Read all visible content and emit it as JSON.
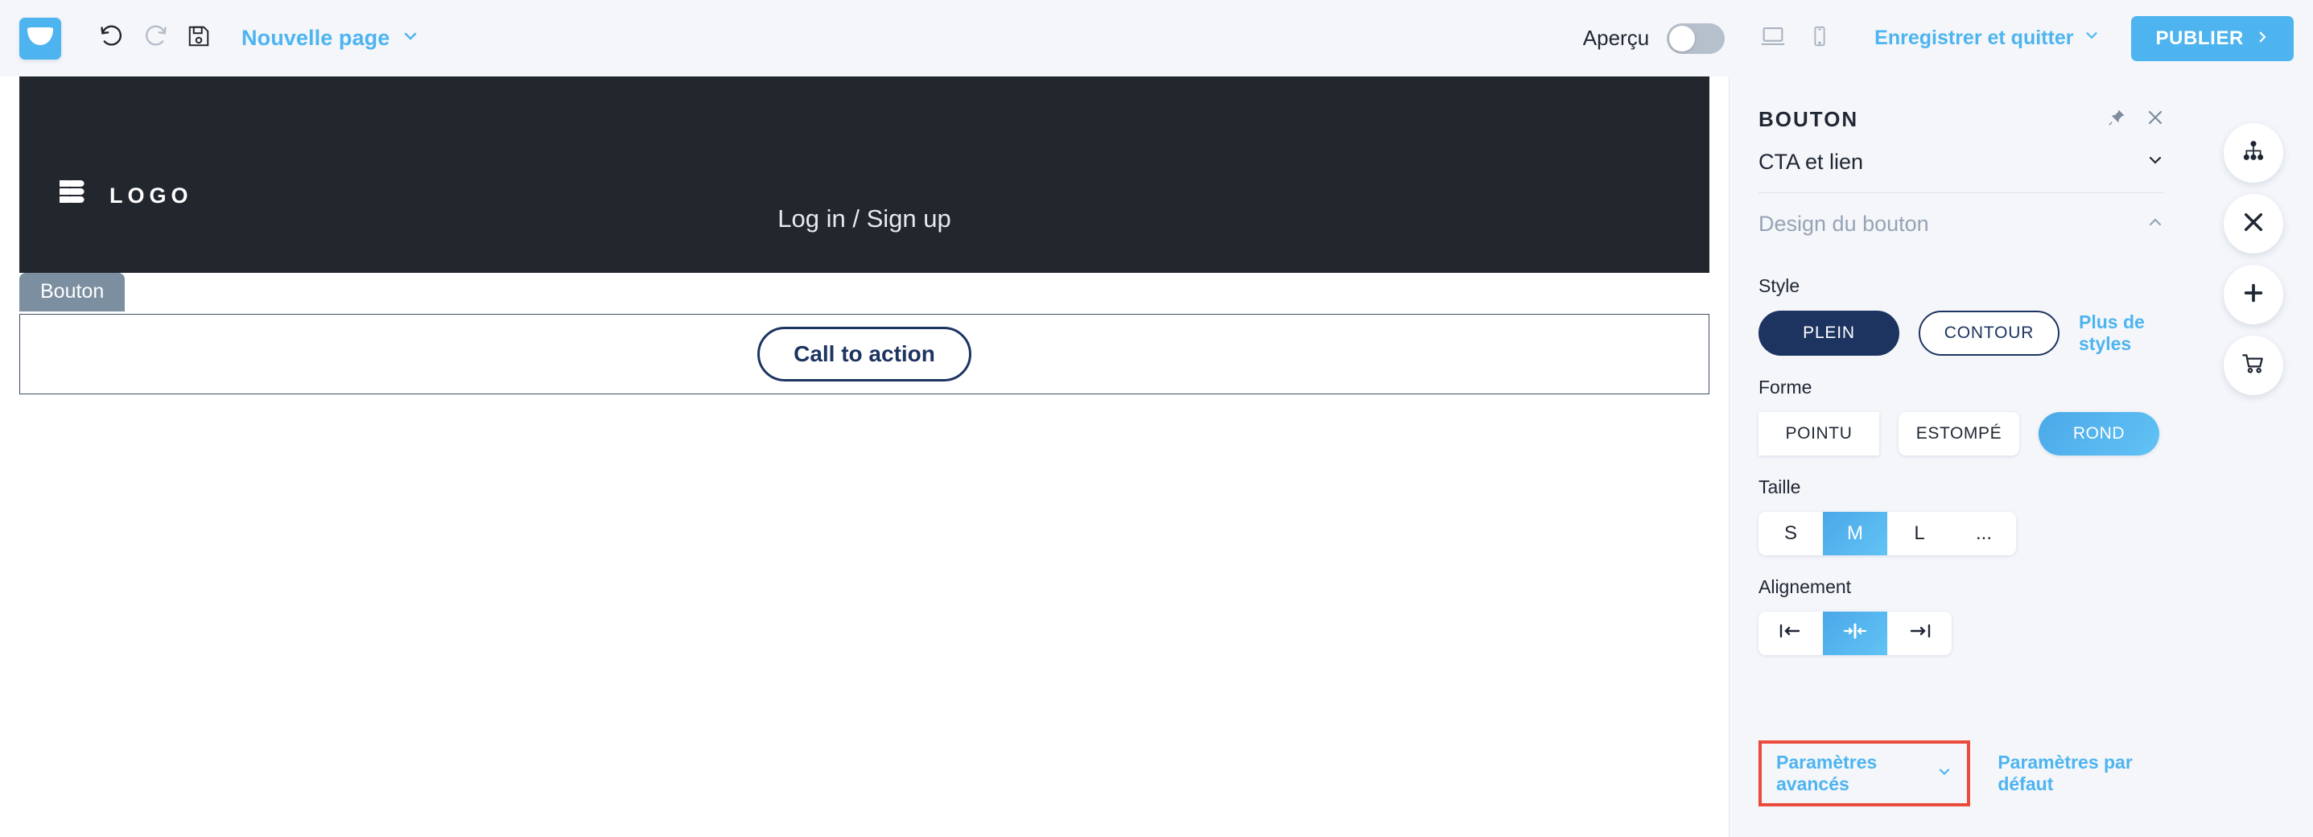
{
  "toolbar": {
    "app_logo_icon": "envelope-smile-logo",
    "undo_icon": "undo-icon",
    "redo_icon": "redo-icon",
    "save_icon": "floppy-save-icon",
    "page_name": "Nouvelle page",
    "page_name_chevron_icon": "chevron-down-icon",
    "preview_label": "Aperçu",
    "preview_toggle_state": "off",
    "desktop_icon": "desktop-icon",
    "mobile_icon": "mobile-icon",
    "save_and_quit": "Enregistrer et quitter",
    "save_quit_chevron_icon": "chevron-down-icon",
    "publish_label": "PUBLIER",
    "publish_arrow_icon": "chevron-right-icon",
    "accent_blue": "#4db4f0"
  },
  "canvas": {
    "header": {
      "logo_mark_icon": "bb-logo-mark",
      "logo_text": "LOGO",
      "nav_text": "Log in / Sign up",
      "background": "#22262d"
    },
    "selected_block": {
      "tab_label": "Bouton",
      "tab_color": "#7c8fa0",
      "cta_label": "Call to action",
      "cta_color": "#1d3461"
    }
  },
  "panel": {
    "title": "BOUTON",
    "pin_icon": "pin-icon",
    "close_icon": "close-icon",
    "sections": [
      {
        "label": "CTA et lien",
        "chevron_icon": "chevron-down-icon",
        "expanded": false
      },
      {
        "label": "Design du bouton",
        "chevron_icon": "chevron-up-icon",
        "expanded": true
      }
    ],
    "style": {
      "label": "Style",
      "options": [
        {
          "label": "PLEIN",
          "selected": true
        },
        {
          "label": "CONTOUR",
          "selected": false
        }
      ],
      "more_styles_link": "Plus de styles"
    },
    "forme": {
      "label": "Forme",
      "options": [
        {
          "label": "POINTU",
          "selected": false
        },
        {
          "label": "ESTOMPÉ",
          "selected": false
        },
        {
          "label": "ROND",
          "selected": true
        }
      ]
    },
    "taille": {
      "label": "Taille",
      "options": [
        {
          "label": "S",
          "selected": false
        },
        {
          "label": "M",
          "selected": true
        },
        {
          "label": "L",
          "selected": false
        },
        {
          "label": "...",
          "selected": false
        }
      ]
    },
    "alignement": {
      "label": "Alignement",
      "options": [
        {
          "icon": "align-left-icon",
          "selected": false
        },
        {
          "icon": "align-center-icon",
          "selected": true
        },
        {
          "icon": "align-right-icon",
          "selected": false
        }
      ]
    },
    "footer": {
      "advanced_label": "Paramètres avancés",
      "advanced_chevron_icon": "chevron-down-icon",
      "advanced_highlight_color": "#eb4b3c",
      "default_label": "Paramètres par défaut"
    }
  },
  "rail": {
    "buttons": [
      {
        "icon": "sitemap-icon"
      },
      {
        "icon": "close-x-icon"
      },
      {
        "icon": "plus-icon"
      },
      {
        "icon": "cart-icon"
      }
    ]
  }
}
